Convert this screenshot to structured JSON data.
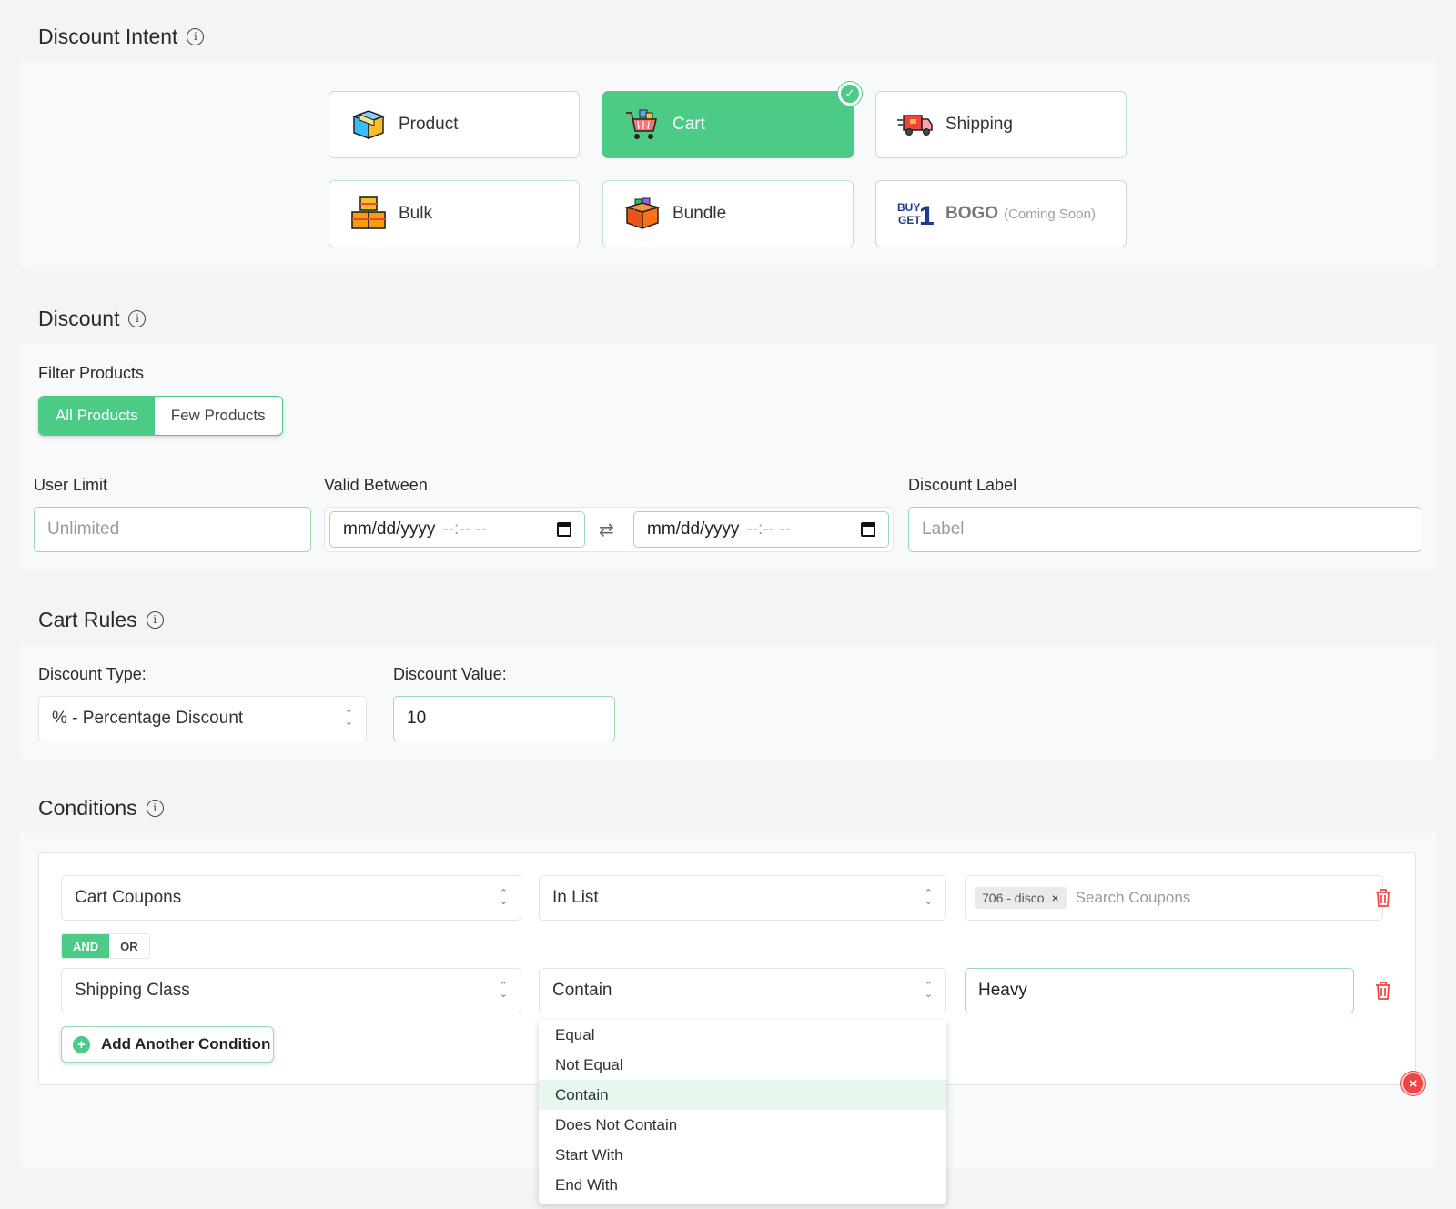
{
  "intent": {
    "title": "Discount Intent",
    "cards": [
      {
        "label": "Product",
        "icon": "product-box-icon"
      },
      {
        "label": "Cart",
        "icon": "shopping-cart-icon",
        "selected": true
      },
      {
        "label": "Shipping",
        "icon": "delivery-truck-icon"
      },
      {
        "label": "Bulk",
        "icon": "stacked-boxes-icon"
      },
      {
        "label": "Bundle",
        "icon": "bundle-box-icon"
      },
      {
        "label": "BOGO",
        "note": "(Coming Soon)",
        "icon": "buy1-get1-icon",
        "badge": "BUY GET 1",
        "disabled": true
      }
    ]
  },
  "discount": {
    "title": "Discount",
    "filter_label": "Filter Products",
    "filter_options": [
      "All Products",
      "Few Products"
    ],
    "user_limit_label": "User Limit",
    "user_limit_placeholder": "Unlimited",
    "valid_between_label": "Valid Between",
    "date_placeholder": "mm/dd/yyyy",
    "time_placeholder": "--:-- --",
    "discount_label_label": "Discount Label",
    "discount_label_placeholder": "Label"
  },
  "cart_rules": {
    "title": "Cart Rules",
    "type_label": "Discount Type:",
    "type_value": "% - Percentage Discount",
    "value_label": "Discount Value:",
    "value": "10"
  },
  "conditions": {
    "title": "Conditions",
    "rows": [
      {
        "field": "Cart Coupons",
        "operator": "In List",
        "tag": "706 - disco",
        "placeholder": "Search Coupons"
      },
      {
        "field": "Shipping Class",
        "operator": "Contain",
        "value": "Heavy"
      }
    ],
    "logic": [
      "AND",
      "OR"
    ],
    "add_label": "Add Another Condition",
    "operator_options": [
      "Equal",
      "Not Equal",
      "Contain",
      "Does Not Contain",
      "Start With",
      "End With"
    ]
  },
  "colors": {
    "accent": "#4ccb87",
    "danger": "#ef4444"
  }
}
